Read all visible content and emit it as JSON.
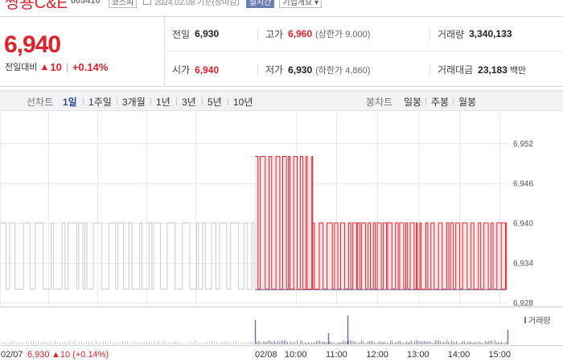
{
  "header": {
    "stock_name": "쌍용C&E",
    "stock_code": "003410",
    "market": "코스피",
    "as_of": "2024.02.08 기준(장마감)",
    "realtime": "실시간",
    "company_info": "기업개요 ▾"
  },
  "summary": {
    "current_price": "6,940",
    "change_label": "전일대비",
    "change_arrow": "▲",
    "change_value": "10",
    "change_pct": "+0.14%",
    "prev_close_label": "전일",
    "prev_close": "6,930",
    "high_label": "고가",
    "high": "6,960",
    "upper_limit": "(상한가 9,000)",
    "volume_label": "거래량",
    "volume": "3,340,133",
    "open_label": "시가",
    "open": "6,940",
    "low_label": "저가",
    "low": "6,930",
    "lower_limit": "(하한가 4,860)",
    "amount_label": "거래대금",
    "amount": "23,183",
    "amount_unit": "백만"
  },
  "toolbar": {
    "line_chart_label": "선차트",
    "line_periods": [
      "1일",
      "1주일",
      "3개월",
      "1년",
      "3년",
      "5년",
      "10년"
    ],
    "active_period": "1일",
    "candle_chart_label": "봉차트",
    "candle_periods": [
      "일봉",
      "주봉",
      "월봉"
    ]
  },
  "chart_data": {
    "type": "line",
    "y_ticks": [
      "6,952",
      "6,946",
      "6,940",
      "6,934",
      "6,928"
    ],
    "ylim": [
      6928,
      6952
    ],
    "prev_close_line": 6930,
    "prev_day_price": 6940,
    "x_ticks": [
      "02/08",
      "10:00",
      "11:00",
      "12:00",
      "13:00",
      "14:00",
      "15:00"
    ],
    "volume_legend": "거래량",
    "footer_prev_date": "02/07",
    "footer_prev_close": "6,930",
    "footer_prev_change": "▲10 (+0.14%)",
    "segments": [
      {
        "from": "09:00",
        "to": "10:25",
        "low": 6930,
        "high": 6950
      },
      {
        "from": "10:25",
        "to": "11:37",
        "low": 6930,
        "high": 6940
      },
      {
        "from": "11:37",
        "to": "15:10",
        "low": 6930,
        "high": 6940
      }
    ],
    "colors": {
      "prev_day": "#c8cbd1",
      "up": "#e5262f",
      "fill": "#fde7e8",
      "down": "#3a57b8",
      "grid": "#e9eaee"
    }
  }
}
